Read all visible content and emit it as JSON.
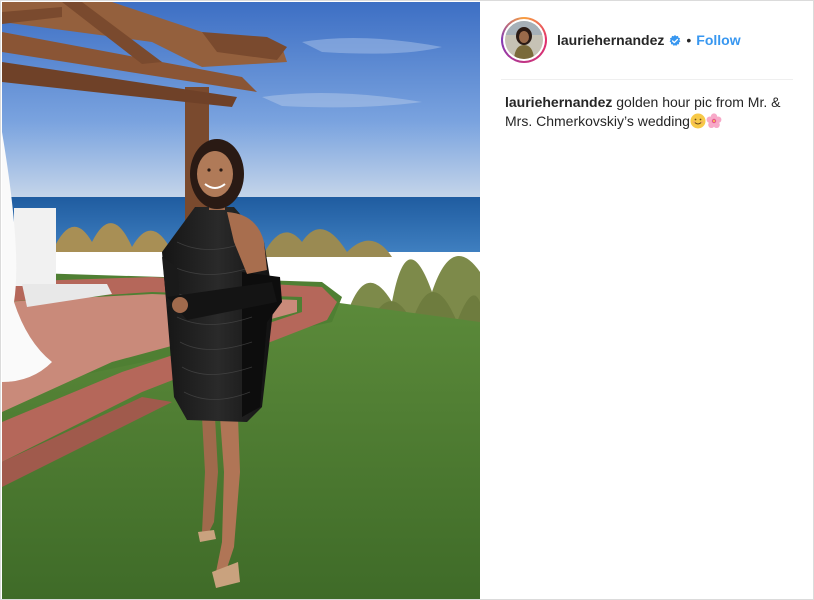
{
  "post": {
    "username": "lauriehernandez",
    "separator": "•",
    "follow_label": "Follow",
    "caption_user": "lauriehernandez",
    "caption_text": "golden hour pic from Mr. & Mrs. Chmerkovskiy’s wedding",
    "caption_emojis": [
      "smiling-face-icon",
      "cherry-blossom-icon"
    ],
    "verified_icon": "verified-badge-icon"
  },
  "colors": {
    "follow": "#3897f0",
    "verified": "#3897f0",
    "text": "#262626",
    "border": "#dbdbdb"
  }
}
